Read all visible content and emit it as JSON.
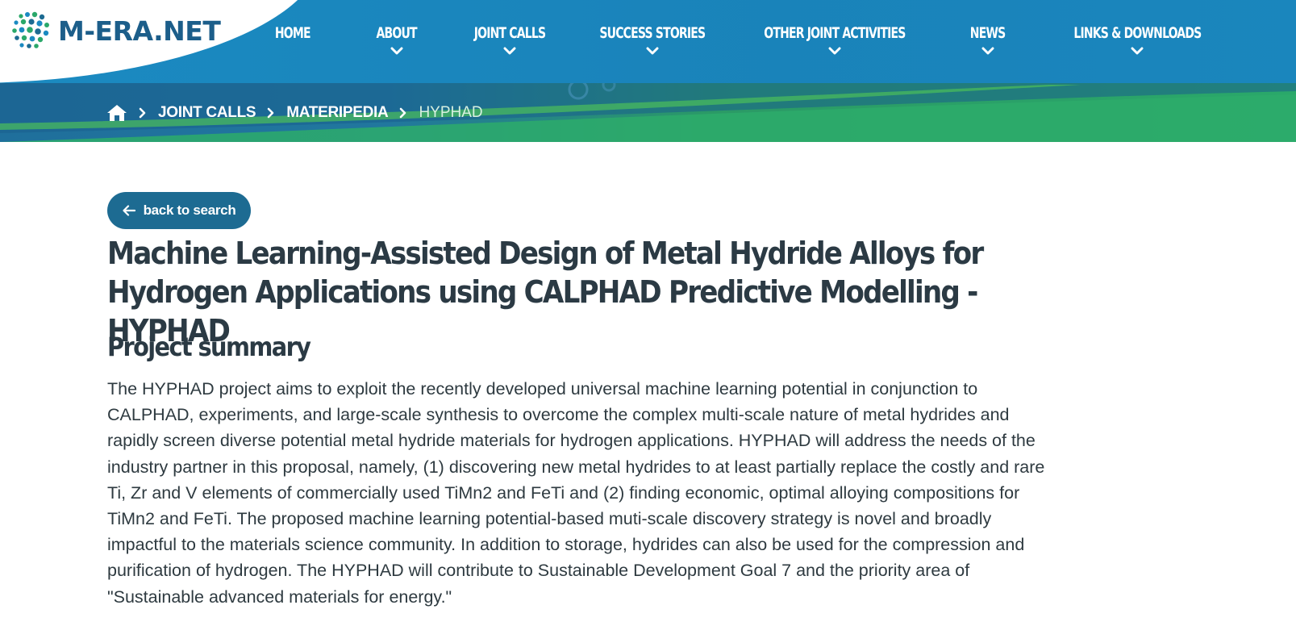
{
  "site": {
    "logo_text": "M-ERA.NET",
    "brand_colors": {
      "header": "#1b8ac1",
      "dark_blue": "#1d6b92",
      "green": "#2aa86a",
      "text": "#2b3a44"
    }
  },
  "nav": {
    "items": [
      {
        "label": "HOME",
        "has_dropdown": false
      },
      {
        "label": "ABOUT",
        "has_dropdown": true
      },
      {
        "label": "JOINT CALLS",
        "has_dropdown": true
      },
      {
        "label": "SUCCESS STORIES",
        "has_dropdown": true
      },
      {
        "label": "OTHER JOINT ACTIVITIES",
        "has_dropdown": true
      },
      {
        "label": "NEWS",
        "has_dropdown": true
      },
      {
        "label": "LINKS & DOWNLOADS",
        "has_dropdown": true
      }
    ]
  },
  "breadcrumb": {
    "home_icon": "home-icon",
    "items": [
      "JOINT CALLS",
      "MATERIPEDIA"
    ],
    "current": "HYPHAD"
  },
  "back_button": {
    "label": "back to search",
    "icon": "arrow-left-icon"
  },
  "project": {
    "title": "Machine Learning-Assisted Design of Metal Hydride Alloys for Hydrogen Applications using CALPHAD Predictive Modelling - HYPHAD",
    "summary_heading": "Project summary",
    "summary": "The HYPHAD project aims to exploit the recently developed universal machine learning potential in conjunction to CALPHAD, experiments, and large-scale synthesis to overcome the complex multi-scale nature of metal hydrides and rapidly screen diverse potential metal hydride materials for hydrogen applications. HYPHAD will address the needs of the industry partner in this proposal, namely, (1) discovering new metal hydrides to at least partially replace the costly and rare Ti, Zr and V elements of commercially used TiMn2 and FeTi and (2) finding economic, optimal alloying compositions for TiMn2 and FeTi. The proposed machine learning potential-based muti-scale discovery strategy is novel and broadly impactful to the materials science community. In addition to storage, hydrides can also be used for the compression and purification of hydrogen. The HYPHAD will contribute to Sustainable Development Goal 7 and the priority area of \"Sustainable advanced materials for energy.\""
  }
}
